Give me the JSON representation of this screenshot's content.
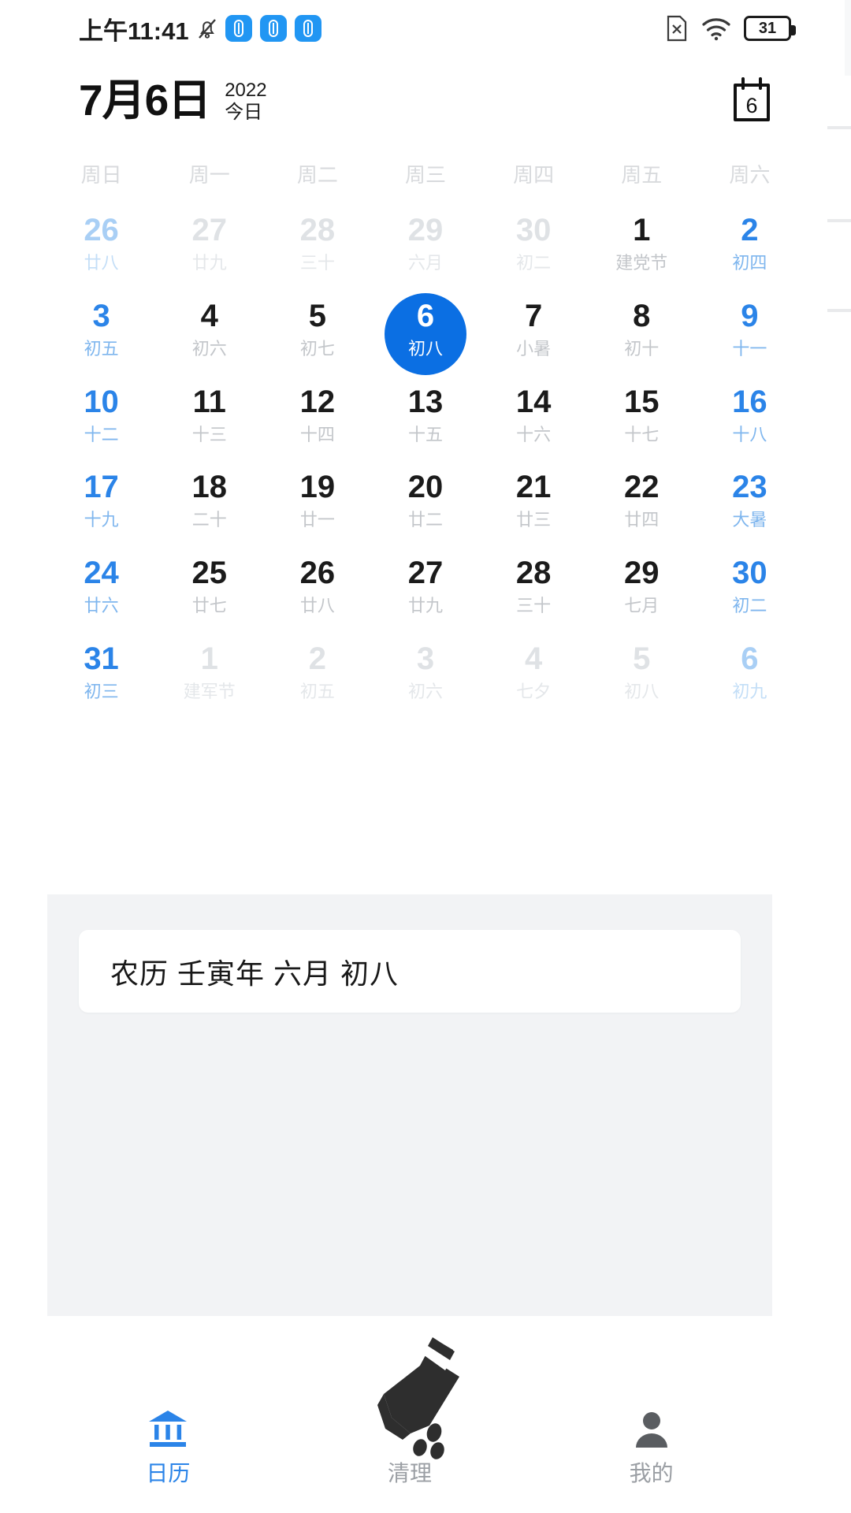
{
  "statusbar": {
    "time": "上午11:41",
    "battery_percent": "31",
    "icons": [
      "mute-bell-icon",
      "app-pill-icon",
      "app-pill-icon",
      "app-pill-icon",
      "sim-x-icon",
      "wifi-icon",
      "battery-icon"
    ]
  },
  "header": {
    "date": "7月6日",
    "year": "2022",
    "today": "今日",
    "icon_day": "6"
  },
  "calendar": {
    "weekdays": [
      "周日",
      "周一",
      "周二",
      "周三",
      "周四",
      "周五",
      "周六"
    ],
    "weeks": [
      [
        {
          "num": "26",
          "lunar": "廿八",
          "other": true,
          "weekend": true,
          "selected": false
        },
        {
          "num": "27",
          "lunar": "廿九",
          "other": true,
          "weekend": false,
          "selected": false
        },
        {
          "num": "28",
          "lunar": "三十",
          "other": true,
          "weekend": false,
          "selected": false
        },
        {
          "num": "29",
          "lunar": "六月",
          "other": true,
          "weekend": false,
          "selected": false
        },
        {
          "num": "30",
          "lunar": "初二",
          "other": true,
          "weekend": false,
          "selected": false
        },
        {
          "num": "1",
          "lunar": "建党节",
          "other": false,
          "weekend": false,
          "selected": false
        },
        {
          "num": "2",
          "lunar": "初四",
          "other": false,
          "weekend": true,
          "selected": false
        }
      ],
      [
        {
          "num": "3",
          "lunar": "初五",
          "other": false,
          "weekend": true,
          "selected": false
        },
        {
          "num": "4",
          "lunar": "初六",
          "other": false,
          "weekend": false,
          "selected": false
        },
        {
          "num": "5",
          "lunar": "初七",
          "other": false,
          "weekend": false,
          "selected": false
        },
        {
          "num": "6",
          "lunar": "初八",
          "other": false,
          "weekend": false,
          "selected": true
        },
        {
          "num": "7",
          "lunar": "小暑",
          "other": false,
          "weekend": false,
          "selected": false
        },
        {
          "num": "8",
          "lunar": "初十",
          "other": false,
          "weekend": false,
          "selected": false
        },
        {
          "num": "9",
          "lunar": "十一",
          "other": false,
          "weekend": true,
          "selected": false
        }
      ],
      [
        {
          "num": "10",
          "lunar": "十二",
          "other": false,
          "weekend": true,
          "selected": false
        },
        {
          "num": "11",
          "lunar": "十三",
          "other": false,
          "weekend": false,
          "selected": false
        },
        {
          "num": "12",
          "lunar": "十四",
          "other": false,
          "weekend": false,
          "selected": false
        },
        {
          "num": "13",
          "lunar": "十五",
          "other": false,
          "weekend": false,
          "selected": false
        },
        {
          "num": "14",
          "lunar": "十六",
          "other": false,
          "weekend": false,
          "selected": false
        },
        {
          "num": "15",
          "lunar": "十七",
          "other": false,
          "weekend": false,
          "selected": false
        },
        {
          "num": "16",
          "lunar": "十八",
          "other": false,
          "weekend": true,
          "selected": false
        }
      ],
      [
        {
          "num": "17",
          "lunar": "十九",
          "other": false,
          "weekend": true,
          "selected": false
        },
        {
          "num": "18",
          "lunar": "二十",
          "other": false,
          "weekend": false,
          "selected": false
        },
        {
          "num": "19",
          "lunar": "廿一",
          "other": false,
          "weekend": false,
          "selected": false
        },
        {
          "num": "20",
          "lunar": "廿二",
          "other": false,
          "weekend": false,
          "selected": false
        },
        {
          "num": "21",
          "lunar": "廿三",
          "other": false,
          "weekend": false,
          "selected": false
        },
        {
          "num": "22",
          "lunar": "廿四",
          "other": false,
          "weekend": false,
          "selected": false
        },
        {
          "num": "23",
          "lunar": "大暑",
          "other": false,
          "weekend": true,
          "selected": false
        }
      ],
      [
        {
          "num": "24",
          "lunar": "廿六",
          "other": false,
          "weekend": true,
          "selected": false
        },
        {
          "num": "25",
          "lunar": "廿七",
          "other": false,
          "weekend": false,
          "selected": false
        },
        {
          "num": "26",
          "lunar": "廿八",
          "other": false,
          "weekend": false,
          "selected": false
        },
        {
          "num": "27",
          "lunar": "廿九",
          "other": false,
          "weekend": false,
          "selected": false
        },
        {
          "num": "28",
          "lunar": "三十",
          "other": false,
          "weekend": false,
          "selected": false
        },
        {
          "num": "29",
          "lunar": "七月",
          "other": false,
          "weekend": false,
          "selected": false
        },
        {
          "num": "30",
          "lunar": "初二",
          "other": false,
          "weekend": true,
          "selected": false
        }
      ],
      [
        {
          "num": "31",
          "lunar": "初三",
          "other": false,
          "weekend": true,
          "selected": false
        },
        {
          "num": "1",
          "lunar": "建军节",
          "other": true,
          "weekend": false,
          "selected": false
        },
        {
          "num": "2",
          "lunar": "初五",
          "other": true,
          "weekend": false,
          "selected": false
        },
        {
          "num": "3",
          "lunar": "初六",
          "other": true,
          "weekend": false,
          "selected": false
        },
        {
          "num": "4",
          "lunar": "七夕",
          "other": true,
          "weekend": false,
          "selected": false
        },
        {
          "num": "5",
          "lunar": "初八",
          "other": true,
          "weekend": false,
          "selected": false
        },
        {
          "num": "6",
          "lunar": "初九",
          "other": true,
          "weekend": true,
          "selected": false
        }
      ]
    ]
  },
  "lunar_card": {
    "text": "农历 壬寅年 六月 初八"
  },
  "bottom_nav": {
    "items": [
      {
        "label": "日历",
        "icon": "bank-calendar-icon",
        "active": true
      },
      {
        "label": "清理",
        "icon": "broom-icon",
        "active": false
      },
      {
        "label": "我的",
        "icon": "person-icon",
        "active": false
      }
    ]
  },
  "colors": {
    "accent": "#2b84e8",
    "selected": "#0b6fe3",
    "muted": "#c3c6ca",
    "card_bg": "#f2f3f5"
  }
}
